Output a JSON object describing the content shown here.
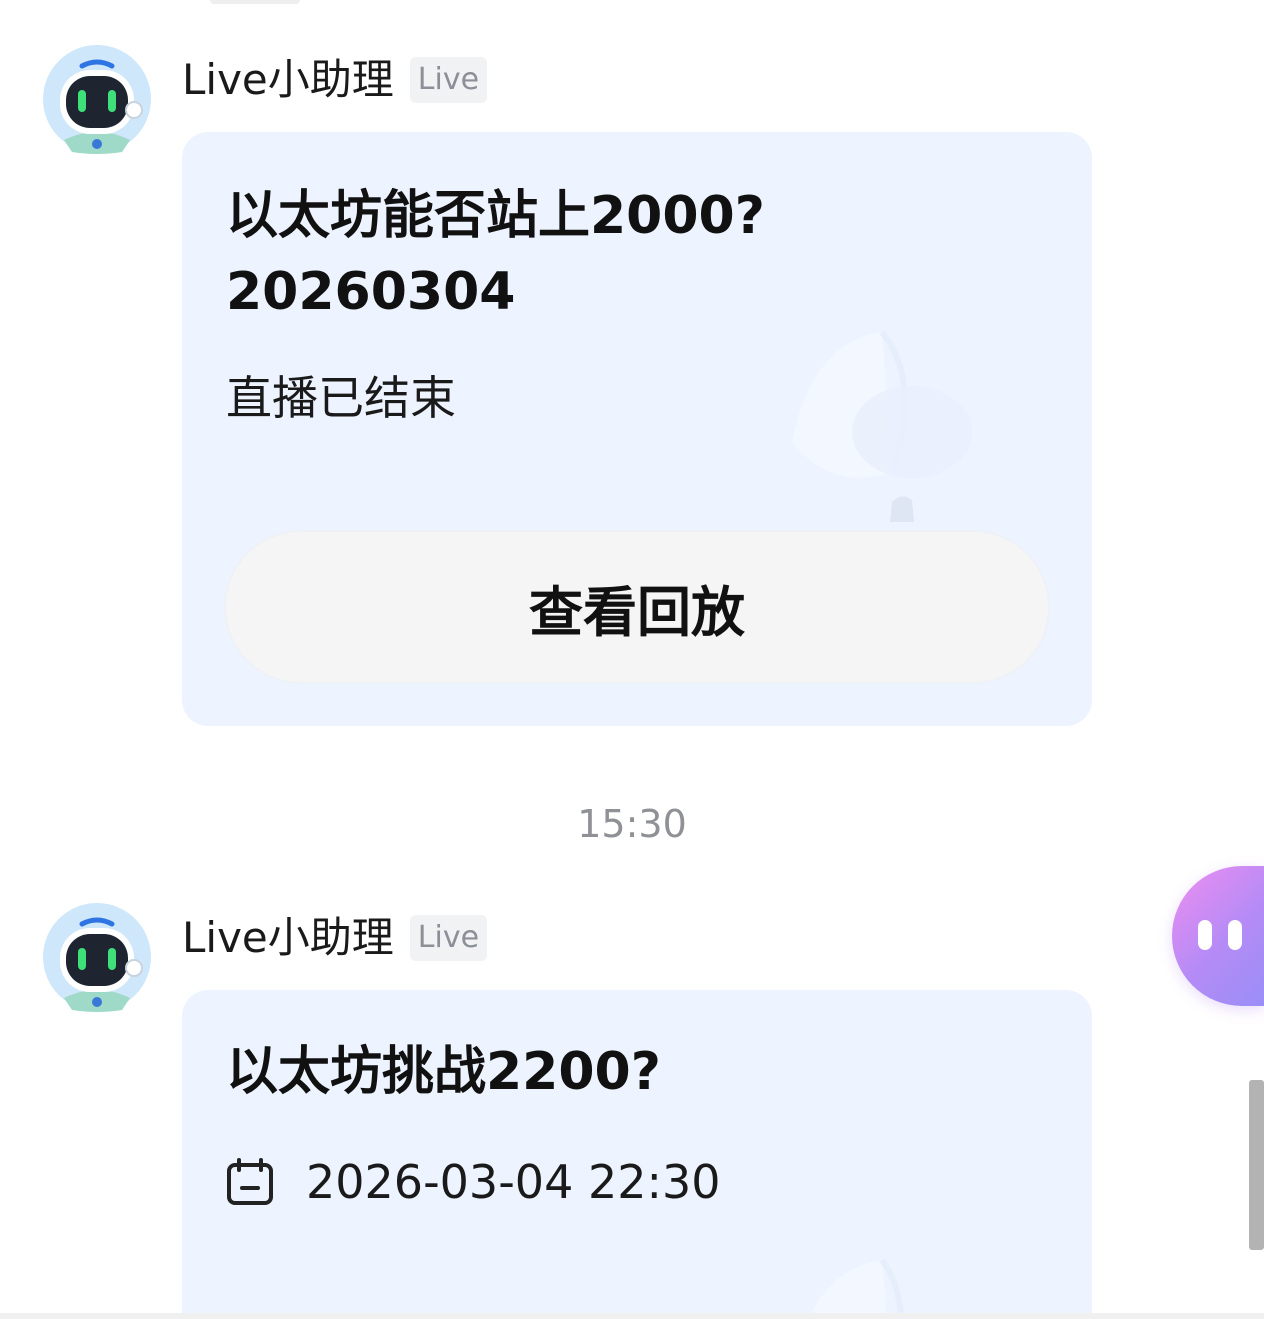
{
  "messages": [
    {
      "sender": "Live小助理",
      "badge": "Live",
      "title_line1": "以太坊能否站上2000?",
      "title_line2": "20260304",
      "status": "直播已结束",
      "button_label": "查看回放"
    },
    {
      "sender": "Live小助理",
      "badge": "Live",
      "title_line1": "以太坊挑战2200?",
      "schedule": "2026-03-04 22:30"
    }
  ],
  "timestamp": "15:30",
  "colors": {
    "card_background": "#edf3ff",
    "button_background": "#f5f5f6",
    "assistant_gradient_start": "#ee8ef0",
    "assistant_gradient_end": "#9b8ef7",
    "robot_eye": "#3ee07a"
  },
  "icons": {
    "avatar": "robot-avatar-icon",
    "calendar": "calendar-icon",
    "decoration": "megaphone-icon",
    "floating": "assistant-bubble-icon"
  }
}
